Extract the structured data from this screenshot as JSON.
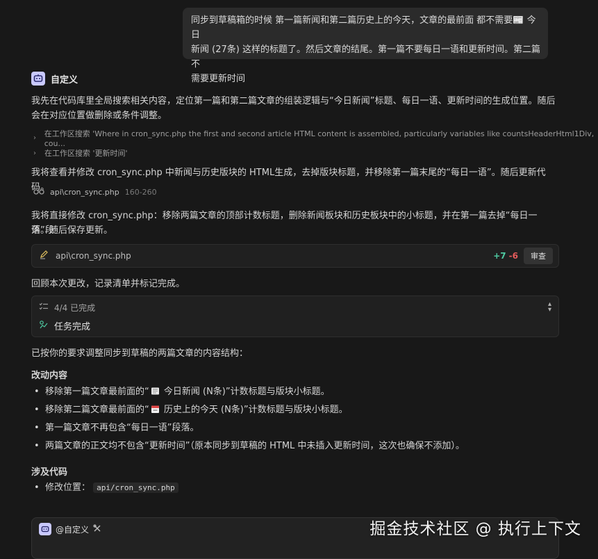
{
  "user_message": {
    "line1": "同步到草稿箱的时候 第一篇新闻和第二篇历史上的今天，文章的最前面 都不需要📰 今日",
    "line2": "新闻 (27条) 这样的标题了。然后文章的结尾。第一篇不要每日一语和更新时间。第二篇不",
    "line3": "需要更新时间"
  },
  "agent": {
    "name": "自定义",
    "para1_line1": "我先在代码库里全局搜索相关内容，定位第一篇和第二篇文章的组装逻辑与“今日新闻”标题、每日一语、更新时间的生成位置。随后",
    "para1_line2": "会在对应位置做删除或条件调整。",
    "search1": "在工作区搜索 'Where in cron_sync.php the first and second article HTML content is assembled, particularly variables like countsHeaderHtml1Div, cou...",
    "search2": "在工作区搜索 '更新时间'",
    "para2": "我将查看并修改 cron_sync.php 中新闻与历史版块的 HTML生成，去掉版块标题，并移除第一篇末尾的“每日一语”。随后更新代码。",
    "file_ref_name": "api\\cron_sync.php",
    "file_ref_range": "160-260",
    "para3_line1": "我将直接修改 cron_sync.php：移除两篇文章的顶部计数标题，删除新闻板块和历史板块中的小标题，并在第一篇去掉“每日一语”段",
    "para3_line2": "落。随后保存更新。",
    "edit_file": "api\\cron_sync.php",
    "edit_added": "+7",
    "edit_removed": "-6",
    "review_label": "审查",
    "para4": "回顾本次更改，记录清单并标记完成。",
    "todo_progress": "4/4 已完成",
    "todo_done": "任务完成",
    "summary": "已按你的要求调整同步到草稿的两篇文章的内容结构：",
    "changes_title": "改动内容",
    "changes": [
      {
        "pre": "移除第一篇文章最前面的“",
        "emoji": "newspaper",
        "post": " 今日新闻 (N条)”计数标题与版块小标题。"
      },
      {
        "pre": "移除第二篇文章最前面的“",
        "emoji": "calendar",
        "post": " 历史上的今天 (N条)”计数标题与版块小标题。"
      },
      {
        "pre": "第一篇文章不再包含“每日一语”段落。",
        "emoji": "",
        "post": ""
      },
      {
        "pre": "两篇文章的正文均不包含“更新时间”（原本同步到草稿的 HTML 中未插入更新时间，这次也确保不添加）。",
        "emoji": "",
        "post": ""
      }
    ],
    "code_title": "涉及代码",
    "code_item_label": "修改位置：",
    "code_item_value": "api/cron_sync.php"
  },
  "input": {
    "mention": "@自定义"
  },
  "watermark": "掘金技术社区 @ 执行上下文",
  "colors": {
    "background": "#181818",
    "bubble": "#2b2b2b",
    "added": "#4ec9a1",
    "removed": "#e55b5b",
    "bot_icon": "#c9c9ff"
  }
}
